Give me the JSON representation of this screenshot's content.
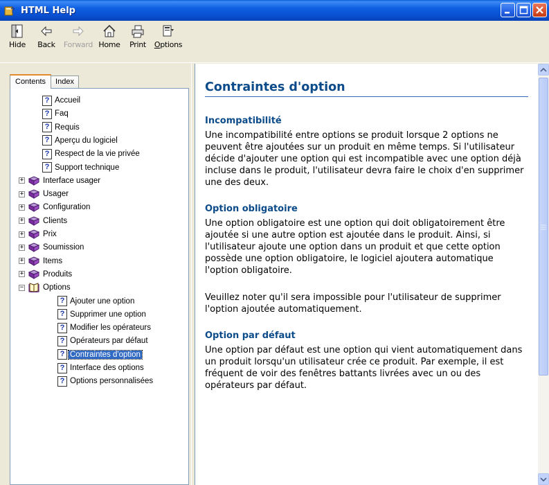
{
  "window": {
    "title": "HTML Help"
  },
  "toolbar": {
    "items": [
      {
        "label": "Hide",
        "icon": "hide-icon",
        "enabled": true
      },
      {
        "label": "Back",
        "icon": "back-arrow-icon",
        "enabled": true
      },
      {
        "label": "Forward",
        "icon": "forward-arrow-icon",
        "enabled": false
      },
      {
        "label": "Home",
        "icon": "home-icon",
        "enabled": true
      },
      {
        "label": "Print",
        "icon": "printer-icon",
        "enabled": true
      },
      {
        "label": "Options",
        "icon": "options-icon",
        "enabled": true
      }
    ]
  },
  "nav_tabs": {
    "contents": "Contents",
    "index": "Index"
  },
  "tree": [
    {
      "label": "Accueil",
      "type": "topic",
      "level": 1
    },
    {
      "label": "Faq",
      "type": "topic",
      "level": 1
    },
    {
      "label": "Requis",
      "type": "topic",
      "level": 1
    },
    {
      "label": "Aperçu du logiciel",
      "type": "topic",
      "level": 1
    },
    {
      "label": "Respect de la vie privée",
      "type": "topic",
      "level": 1
    },
    {
      "label": "Support technique",
      "type": "topic",
      "level": 1
    },
    {
      "label": "Interface usager",
      "type": "book",
      "expanded": false
    },
    {
      "label": "Usager",
      "type": "book",
      "expanded": false
    },
    {
      "label": "Configuration",
      "type": "book",
      "expanded": false
    },
    {
      "label": "Clients",
      "type": "book",
      "expanded": false
    },
    {
      "label": "Prix",
      "type": "book",
      "expanded": false
    },
    {
      "label": "Soumission",
      "type": "book",
      "expanded": false
    },
    {
      "label": "Items",
      "type": "book",
      "expanded": false
    },
    {
      "label": "Produits",
      "type": "book",
      "expanded": false
    },
    {
      "label": "Options",
      "type": "book",
      "expanded": true
    },
    {
      "label": "Ajouter une option",
      "type": "topic",
      "level": 2
    },
    {
      "label": "Supprimer une option",
      "type": "topic",
      "level": 2
    },
    {
      "label": "Modifier les opérateurs",
      "type": "topic",
      "level": 2
    },
    {
      "label": "Opérateurs par défaut",
      "type": "topic",
      "level": 2
    },
    {
      "label": "Contraintes d'option",
      "type": "topic",
      "level": 2,
      "selected": true
    },
    {
      "label": "Interface des options",
      "type": "topic",
      "level": 2
    },
    {
      "label": "Options personnalisées",
      "type": "topic",
      "level": 2
    }
  ],
  "content": {
    "title": "Contraintes d'option",
    "sections": [
      {
        "heading": "Incompatibilité",
        "paragraphs": [
          "Une incompatibilité entre options se produit lorsque 2 options ne peuvent être ajoutées sur un produit en même temps. Si l'utilisateur décide d'ajouter une option qui est incompatible avec une option déjà incluse dans le produit, l'utilisateur devra faire le choix d'en supprimer une des deux."
        ]
      },
      {
        "heading": "Option obligatoire",
        "paragraphs": [
          "Une option obligatoire est une option qui doit obligatoirement être ajoutée si une autre option est ajoutée dans le produit. Ainsi, si l'utilisateur ajoute une option dans un produit et que cette option possède une option obligatoire, le logiciel ajoutera automatique l'option obligatoire.",
          "Veuillez noter qu'il sera impossible pour l'utilisateur de supprimer l'option ajoutée automatiquement."
        ]
      },
      {
        "heading": "Option par défaut",
        "paragraphs": [
          "Une option par défaut est une option qui vient automatiquement dans un produit lorsqu'un utilisateur crée ce produit. Par exemple, il est fréquent de voir des fenêtres battants livrées avec un ou des opérateurs par défaut."
        ]
      }
    ]
  },
  "colors": {
    "heading": "#0c4b8a",
    "selection": "#316ac5",
    "titlebar": "#0a52d4"
  }
}
